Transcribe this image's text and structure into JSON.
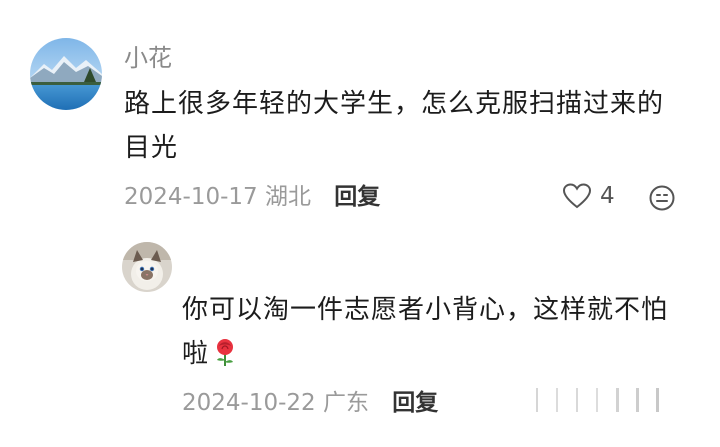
{
  "comment": {
    "username": "小花",
    "text_line1": "路上很多年轻的大学生，怎么克服扫描过来的",
    "text_line2": "目光",
    "date": "2024-10-17",
    "location": "湖北",
    "reply_label": "回复",
    "like_count": "4"
  },
  "reply": {
    "text_line1": "你可以淘一件志愿者小背心，这样就不怕",
    "text_line2": "啦",
    "date": "2024-10-22",
    "location": "广东",
    "reply_label": "回复"
  },
  "colors": {
    "meta_gray": "#9a9a9a",
    "username_gray": "#8a8a8a",
    "text": "#1c1c1c"
  }
}
